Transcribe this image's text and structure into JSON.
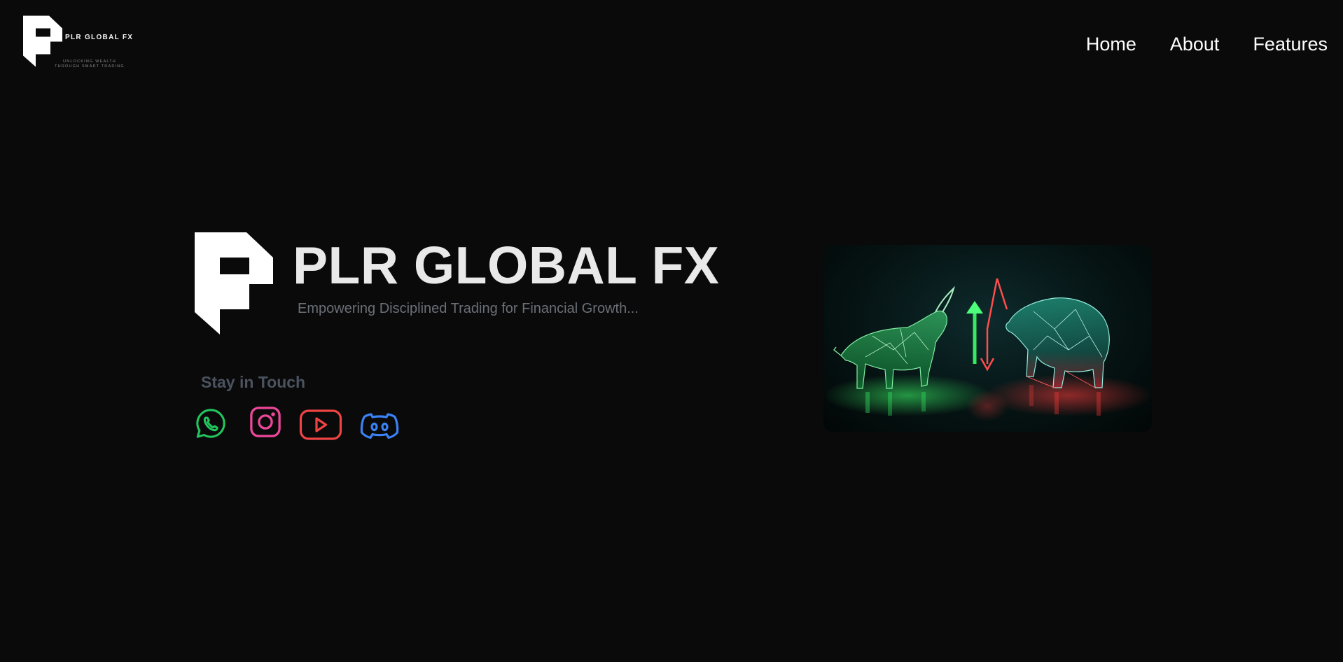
{
  "header": {
    "logo": {
      "brand": "PLR GLOBAL FX",
      "tagline": "UNLOCKING WEALTH THROUGH SMART TRADING",
      "icon": "plr-logo-mark"
    },
    "nav": [
      {
        "label": "Home"
      },
      {
        "label": "About"
      },
      {
        "label": "Features"
      }
    ]
  },
  "hero": {
    "title": "PLR GLOBAL FX",
    "subtitle": "Empowering Disciplined Trading for Financial Growth...",
    "stay_in_touch": "Stay in Touch",
    "socials": [
      {
        "icon": "whatsapp-icon",
        "color": "#22c55e"
      },
      {
        "icon": "instagram-icon",
        "color": "#ec4899"
      },
      {
        "icon": "youtube-icon",
        "color": "#ef4444"
      },
      {
        "icon": "discord-icon",
        "color": "#3b82f6"
      }
    ],
    "image": {
      "icon": "bull-vs-bear-image",
      "accent_green": "#3cff6a",
      "accent_red": "#ff3b3b"
    }
  },
  "colors": {
    "background": "#0a0a0a",
    "title": "#e9e9e9",
    "subtitle": "#6a6f78",
    "stay_title": "#4b5360"
  }
}
